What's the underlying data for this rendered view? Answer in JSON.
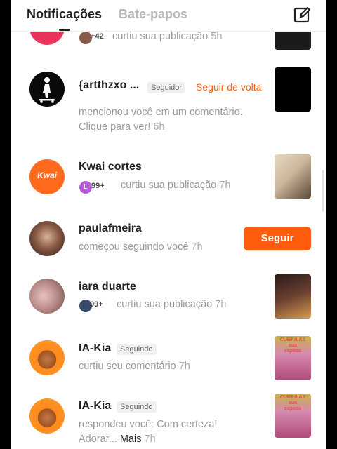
{
  "header": {
    "tab_notifications": "Notificações",
    "tab_chats": "Bate-papos",
    "compose_icon": "compose-icon"
  },
  "rows": [
    {
      "extra_count": "+42",
      "action": "curtiu sua publicação",
      "time": "5h"
    },
    {
      "name": "{artthzxo ...",
      "badge": "Seguidor",
      "follow_back": "Seguir de volta",
      "action_line1": "mencionou você em um comentário.",
      "action_line2": "Clique para ver!",
      "time": "6h"
    },
    {
      "name": "Kwai cortes",
      "avatar_text": "Kwai",
      "cluster_letter": "L",
      "count": "99+",
      "action": "curtiu sua publicação",
      "time": "7h"
    },
    {
      "name": "paulafmeira",
      "action": "começou seguindo você",
      "time": "7h",
      "button": "Seguir"
    },
    {
      "name": "iara duarte",
      "count": "99+",
      "action": "curtiu sua publicação",
      "time": "7h"
    },
    {
      "name": "IA-Kia",
      "badge": "Seguindo",
      "action": "curtiu seu comentário",
      "time": "7h",
      "thumb_caption": "CUBRA AS\nsua\nesposa"
    },
    {
      "name": "IA-Kia",
      "badge": "Seguindo",
      "action_line1": "respondeu você: Com certeza!",
      "action_line2": "Adorar...",
      "more": "Mais",
      "time": "7h",
      "thumb_caption": "CUBRA AS\nsua\nesposa"
    }
  ],
  "colors": {
    "accent": "#ff5c0e",
    "text": "#222222",
    "muted": "#9a9a9a"
  }
}
